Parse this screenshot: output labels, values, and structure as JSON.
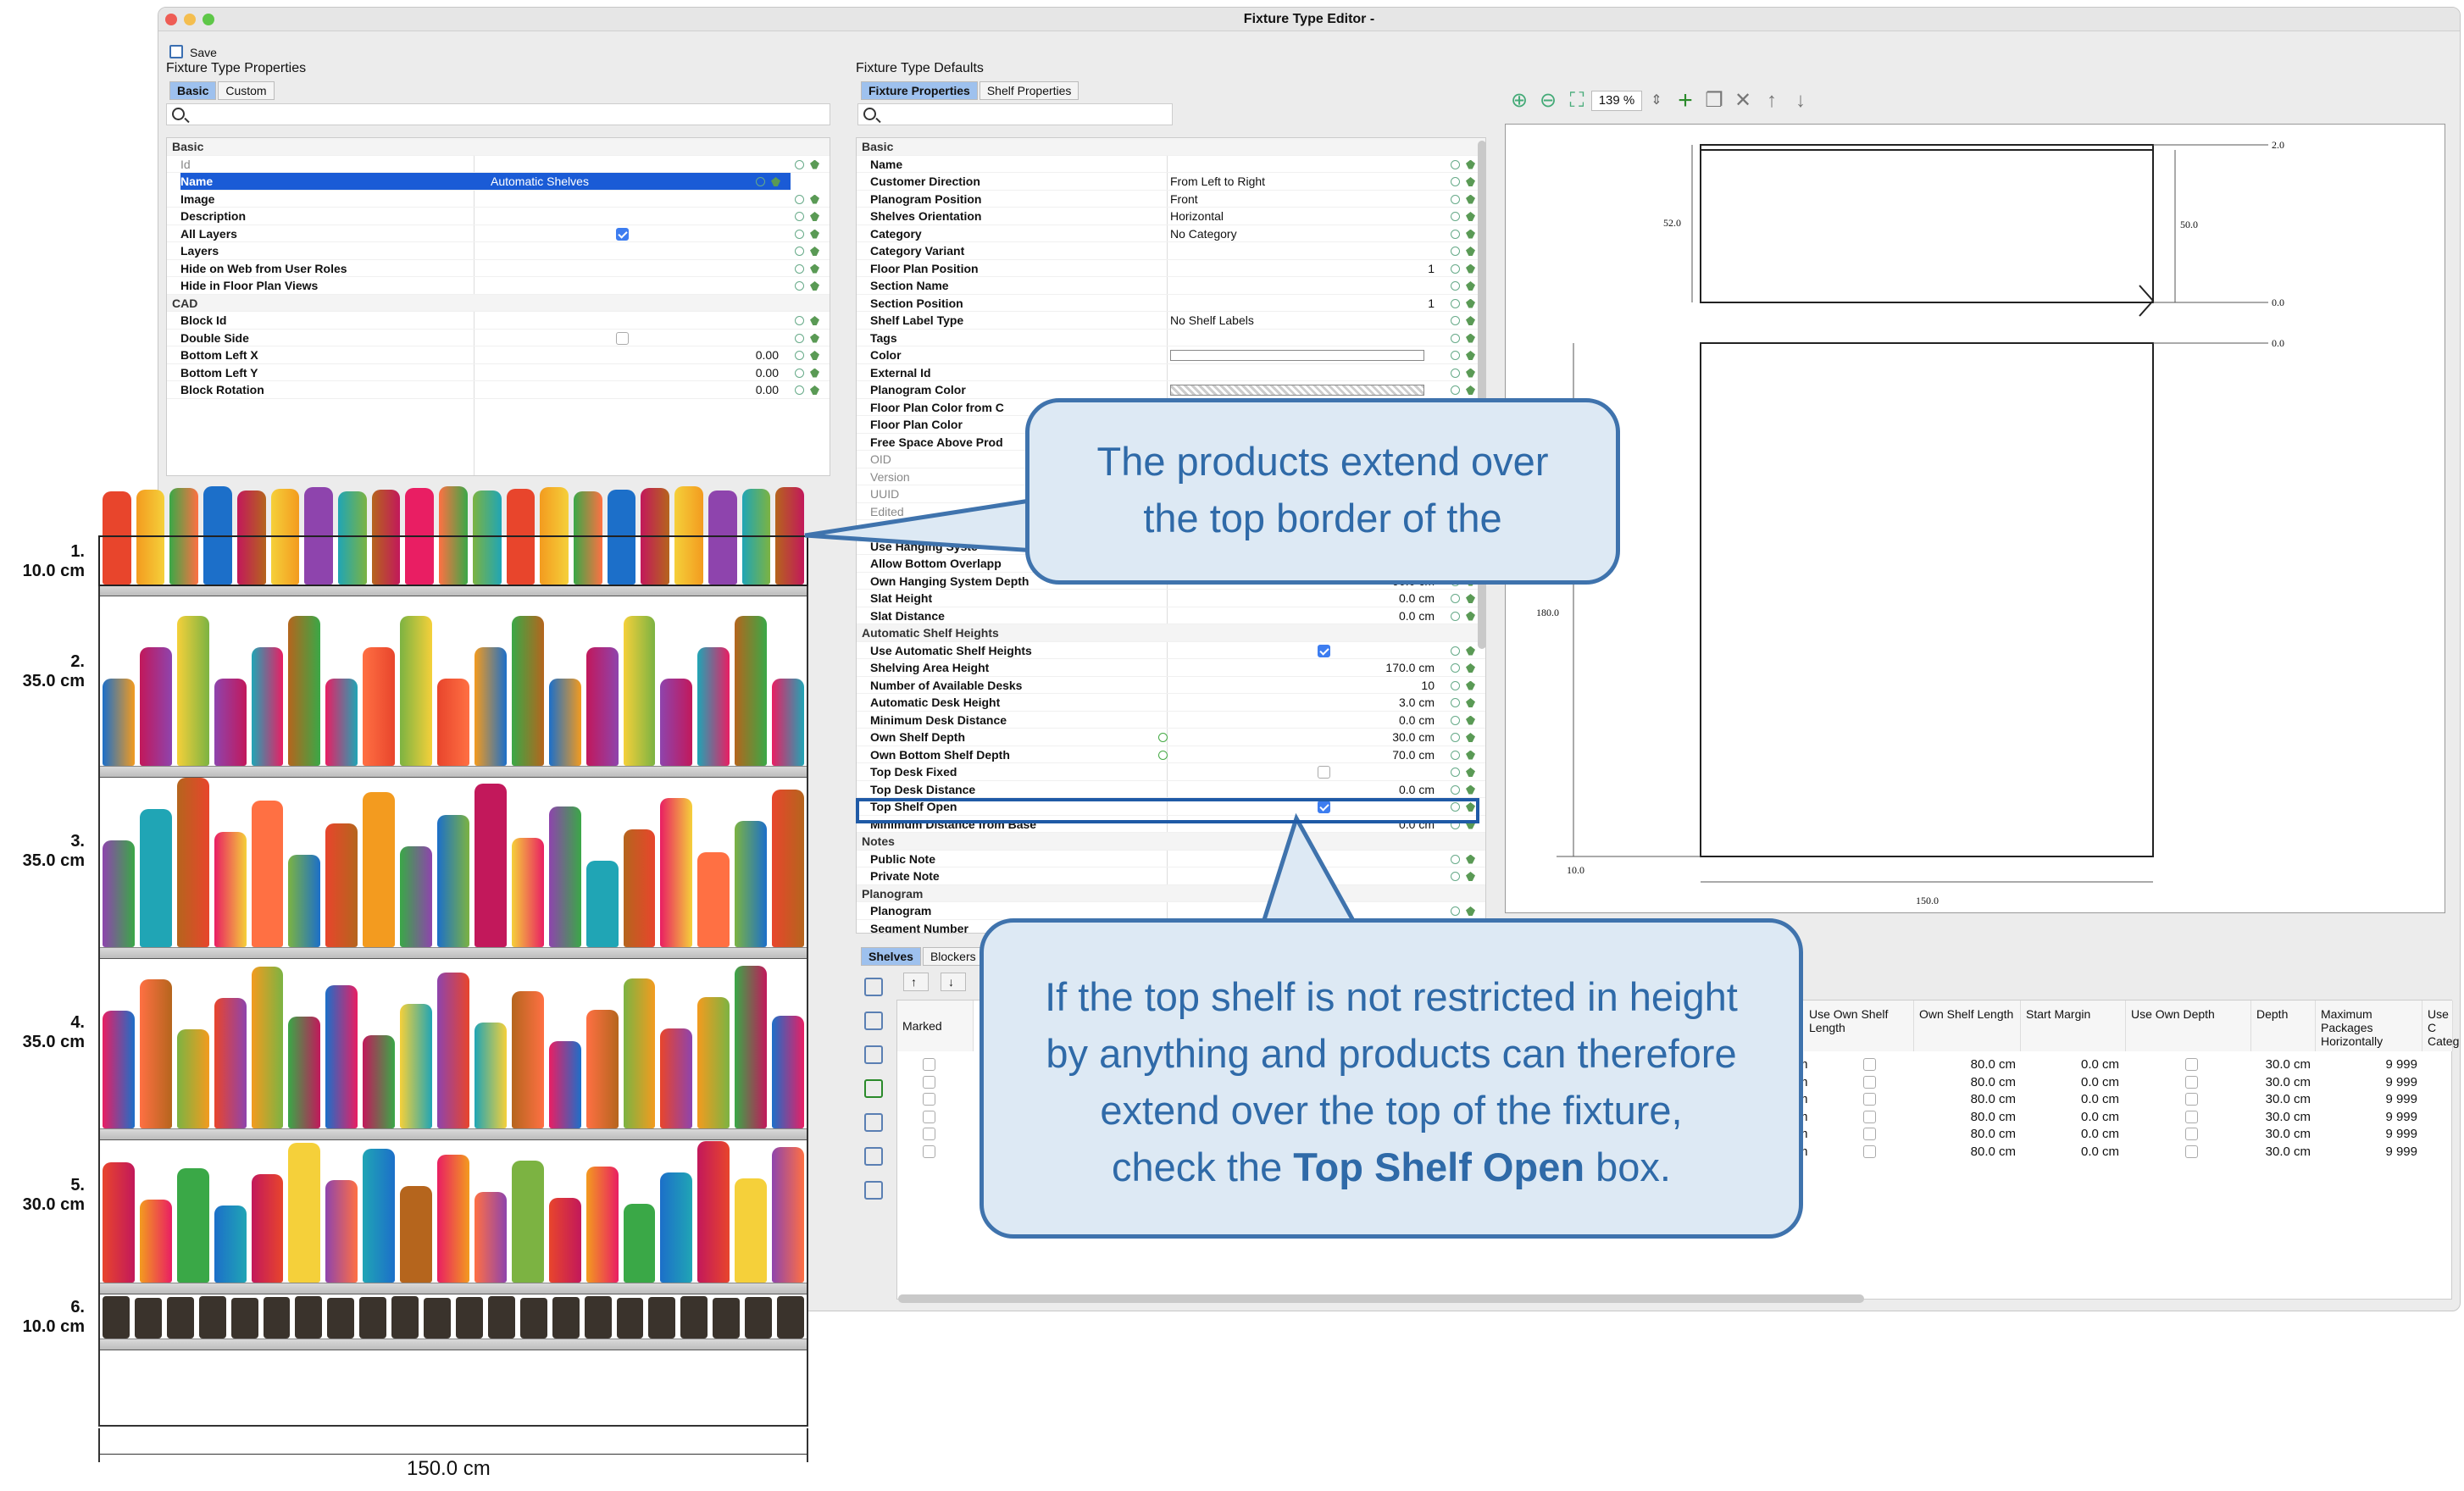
{
  "window": {
    "title": "Fixture Type Editor -"
  },
  "toolbar": {
    "save_label": "Save"
  },
  "left_panel": {
    "group_title": "Fixture Type Properties",
    "tabs": [
      "Basic",
      "Custom"
    ],
    "rows": [
      {
        "section": "Basic"
      },
      {
        "label": "Id",
        "dim": true
      },
      {
        "label": "Name",
        "value": "Automatic Shelves",
        "selected": true
      },
      {
        "label": "Image"
      },
      {
        "label": "Description"
      },
      {
        "label": "All Layers",
        "check": true
      },
      {
        "label": "Layers"
      },
      {
        "label": "Hide on Web from User Roles"
      },
      {
        "label": "Hide in Floor Plan Views"
      },
      {
        "section": "CAD"
      },
      {
        "label": "Block Id"
      },
      {
        "label": "Double Side",
        "check": false
      },
      {
        "label": "Bottom Left X",
        "num": "0.00"
      },
      {
        "label": "Bottom Left Y",
        "num": "0.00"
      },
      {
        "label": "Block Rotation",
        "num": "0.00"
      }
    ]
  },
  "mid_panel": {
    "group_title": "Fixture Type Defaults",
    "tabs": [
      "Fixture Properties",
      "Shelf Properties"
    ],
    "rows": [
      {
        "section": "Basic"
      },
      {
        "label": "Name"
      },
      {
        "label": "Customer Direction",
        "value": "From Left to Right"
      },
      {
        "label": "Planogram Position",
        "value": "Front"
      },
      {
        "label": "Shelves Orientation",
        "value": "Horizontal"
      },
      {
        "label": "Category",
        "value": "No Category"
      },
      {
        "label": "Category Variant"
      },
      {
        "label": "Floor Plan Position",
        "num": "1"
      },
      {
        "label": "Section Name"
      },
      {
        "label": "Section Position",
        "num": "1"
      },
      {
        "label": "Shelf Label Type",
        "value": "No Shelf Labels"
      },
      {
        "label": "Tags"
      },
      {
        "label": "Color",
        "swatch": "white"
      },
      {
        "label": "External Id"
      },
      {
        "label": "Planogram Color",
        "swatch": "checker"
      },
      {
        "label": "Floor Plan Color from C"
      },
      {
        "label": "Floor Plan Color"
      },
      {
        "label": "Free Space Above Prod"
      },
      {
        "label": "OID",
        "dim": true
      },
      {
        "label": "Version",
        "dim": true
      },
      {
        "label": "UUID",
        "dim": true
      },
      {
        "label": "Edited",
        "dim": true
      },
      {
        "label": ""
      },
      {
        "label": "Use Hanging Syste"
      },
      {
        "label": "Allow Bottom Overlapp"
      },
      {
        "label": "Own Hanging System Depth",
        "num": "90.0 cm"
      },
      {
        "label": "Slat Height",
        "num": "0.0 cm"
      },
      {
        "label": "Slat Distance",
        "num": "0.0 cm"
      },
      {
        "section": "Automatic Shelf Heights"
      },
      {
        "label": "Use Automatic Shelf Heights",
        "check": true
      },
      {
        "label": "Shelving Area Height",
        "num": "170.0 cm"
      },
      {
        "label": "Number of Available Desks",
        "num": "10"
      },
      {
        "label": "Automatic Desk Height",
        "num": "3.0 cm"
      },
      {
        "label": "Minimum Desk Distance",
        "num": "0.0 cm"
      },
      {
        "label": "Own Shelf Depth",
        "num": "30.0 cm",
        "own": true
      },
      {
        "label": "Own Bottom Shelf Depth",
        "num": "70.0 cm",
        "own": true
      },
      {
        "label": "Top Desk Fixed",
        "check": false
      },
      {
        "label": "Top Desk Distance",
        "num": "0.0 cm"
      },
      {
        "label": "Top Shelf Open",
        "check": true,
        "highlight": true
      },
      {
        "label": "Minimum Distance from Base",
        "num": "0.0 cm"
      },
      {
        "section": "Notes"
      },
      {
        "label": "Public Note"
      },
      {
        "label": "Private Note"
      },
      {
        "section": "Planogram"
      },
      {
        "label": "Planogram"
      },
      {
        "label": "Segment Number"
      }
    ]
  },
  "preview": {
    "zoom": "139 %",
    "dims": {
      "top_right": "2.0",
      "left_top": "52.0",
      "right_top": "50.0",
      "zero1": "0.0",
      "zero2": "0.0",
      "left_mid": "180.0",
      "bottom_left": "10.0",
      "bottom_width": "150.0"
    }
  },
  "shelves_panel": {
    "tabs": [
      "Shelves",
      "Blockers"
    ],
    "headers": [
      "Marked",
      "Use Own Shelf Length",
      "Own Shelf Length",
      "Start Margin",
      "Use Own Depth",
      "Depth",
      "Maximum Packages Horizontally",
      "Use C Categ"
    ],
    "rows": [
      {
        "prefix": "m",
        "length": "80.0 cm",
        "margin": "0.0 cm",
        "depth": "30.0 cm",
        "max": "9 999"
      },
      {
        "prefix": "m",
        "length": "80.0 cm",
        "margin": "0.0 cm",
        "depth": "30.0 cm",
        "max": "9 999"
      },
      {
        "prefix": "m",
        "length": "80.0 cm",
        "margin": "0.0 cm",
        "depth": "30.0 cm",
        "max": "9 999"
      },
      {
        "prefix": "m",
        "length": "80.0 cm",
        "margin": "0.0 cm",
        "depth": "30.0 cm",
        "max": "9 999"
      },
      {
        "prefix": "m",
        "length": "80.0 cm",
        "margin": "0.0 cm",
        "depth": "30.0 cm",
        "max": "9 999"
      },
      {
        "prefix": "m",
        "length": "80.0 cm",
        "margin": "0.0 cm",
        "depth": "30.0 cm",
        "max": "9 999"
      }
    ]
  },
  "callouts": {
    "top": [
      "The products extend over",
      "the top border of the"
    ],
    "bottom_lines": [
      "If the top shelf is not restricted in height",
      "by anything and products can therefore",
      "extend over the top of the fixture,"
    ],
    "bottom_pre": "check the ",
    "bottom_bold": "Top Shelf Open",
    "bottom_post": " box."
  },
  "planogram": {
    "shelves": [
      {
        "num": "1.",
        "size": "10.0 cm"
      },
      {
        "num": "2.",
        "size": "35.0 cm"
      },
      {
        "num": "3.",
        "size": "35.0 cm"
      },
      {
        "num": "4.",
        "size": "35.0 cm"
      },
      {
        "num": "5.",
        "size": "30.0 cm"
      },
      {
        "num": "6.",
        "size": "10.0 cm"
      }
    ],
    "width_label": "150.0 cm"
  },
  "colors": {
    "accent": "#3f73ad",
    "selection": "#1a5bd6",
    "callout_bg": "#dde9f4"
  }
}
